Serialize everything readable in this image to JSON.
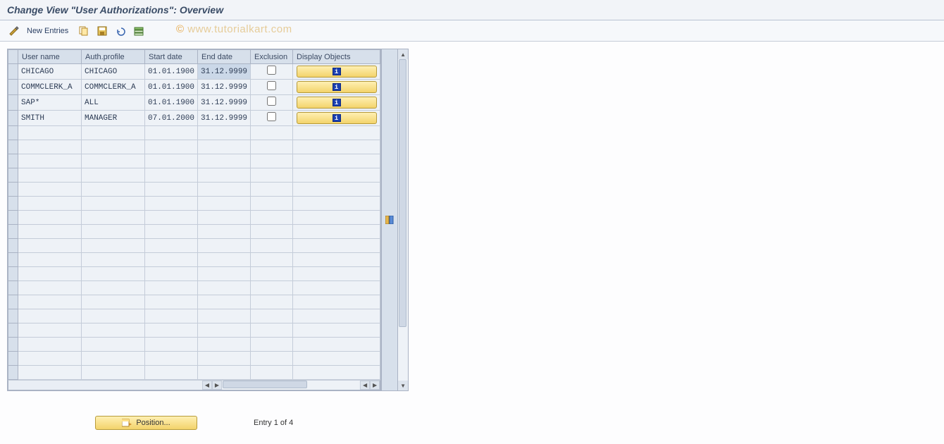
{
  "title": "Change View \"User Authorizations\": Overview",
  "toolbar": {
    "new_entries_label": "New Entries",
    "icons": {
      "toggle": "toggle-display-change-icon",
      "copy": "copy-icon",
      "save": "save-icon",
      "delete": "delete-icon",
      "select_all": "select-all-icon"
    }
  },
  "watermark": "© www.tutorialkart.com",
  "table": {
    "columns": [
      "User name",
      "Auth.profile",
      "Start date",
      "End date",
      "Exclusion",
      "Display Objects"
    ],
    "rows": [
      {
        "user_name": "CHICAGO",
        "auth_profile": "CHICAGO",
        "start_date": "01.01.1900",
        "end_date": "31.12.9999",
        "exclusion": false,
        "end_selected": true
      },
      {
        "user_name": "COMMCLERK_A",
        "auth_profile": "COMMCLERK_A",
        "start_date": "01.01.1900",
        "end_date": "31.12.9999",
        "exclusion": false,
        "end_selected": false
      },
      {
        "user_name": "SAP*",
        "auth_profile": "ALL",
        "start_date": "01.01.1900",
        "end_date": "31.12.9999",
        "exclusion": false,
        "end_selected": false
      },
      {
        "user_name": "SMITH",
        "auth_profile": "MANAGER",
        "start_date": "07.01.2000",
        "end_date": "31.12.9999",
        "exclusion": false,
        "end_selected": false
      }
    ],
    "empty_row_count": 18
  },
  "footer": {
    "position_label": "Position...",
    "entry_text": "Entry 1 of 4"
  }
}
